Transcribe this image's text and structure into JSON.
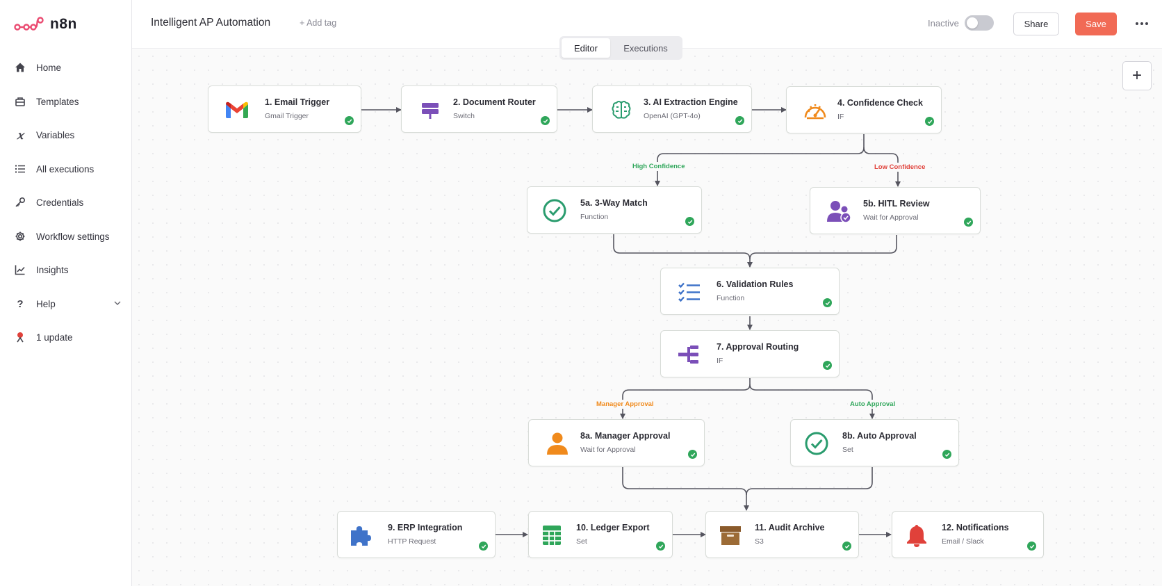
{
  "app": {
    "logo_text": "n8n",
    "accent": "#f16a55"
  },
  "sidebar": {
    "items": [
      {
        "label": "Home",
        "icon": "home-icon"
      },
      {
        "label": "Templates",
        "icon": "templates-icon"
      },
      {
        "label": "Variables",
        "icon": "variables-icon"
      },
      {
        "label": "All executions",
        "icon": "list-icon"
      },
      {
        "label": "Credentials",
        "icon": "key-icon"
      },
      {
        "label": "Workflow settings",
        "icon": "gear-icon"
      },
      {
        "label": "Insights",
        "icon": "chart-icon"
      },
      {
        "label": "Help",
        "icon": "question-icon"
      },
      {
        "label": "1 update",
        "icon": "update-icon"
      }
    ]
  },
  "header": {
    "workflow_title": "Intelligent AP Automation",
    "add_tag": "+ Add tag",
    "status_label": "Inactive",
    "share_label": "Share",
    "save_label": "Save"
  },
  "tabs": {
    "editor": "Editor",
    "executions": "Executions"
  },
  "canvas": {
    "zoom_button": "+"
  },
  "nodes": {
    "n1": {
      "title": "1. Email Trigger",
      "subtitle": "Gmail Trigger"
    },
    "n2": {
      "title": "2. Document Router",
      "subtitle": "Switch"
    },
    "n3": {
      "title": "3. AI Extraction Engine",
      "subtitle": "OpenAI (GPT-4o)"
    },
    "n4": {
      "title": "4. Confidence Check",
      "subtitle": "IF"
    },
    "n5a": {
      "title": "5a. 3-Way Match",
      "subtitle": "Function"
    },
    "n5b": {
      "title": "5b. HITL Review",
      "subtitle": "Wait for Approval"
    },
    "n6": {
      "title": "6. Validation Rules",
      "subtitle": "Function"
    },
    "n7": {
      "title": "7. Approval Routing",
      "subtitle": "IF"
    },
    "n8a": {
      "title": "8a. Manager Approval",
      "subtitle": "Wait for Approval"
    },
    "n8b": {
      "title": "8b. Auto Approval",
      "subtitle": "Set"
    },
    "n9": {
      "title": "9. ERP Integration",
      "subtitle": "HTTP Request"
    },
    "n10": {
      "title": "10. Ledger Export",
      "subtitle": "Set"
    },
    "n11": {
      "title": "11. Audit Archive",
      "subtitle": "S3"
    },
    "n12": {
      "title": "12. Notifications",
      "subtitle": "Email / Slack"
    }
  },
  "edge_labels": {
    "high": {
      "text": "High Confidence",
      "color": "#2fa65a"
    },
    "low": {
      "text": "Low Confidence",
      "color": "#e0413a"
    },
    "manager": {
      "text": "Manager Approval",
      "color": "#f08a1c"
    },
    "auto": {
      "text": "Auto Approval",
      "color": "#2fa65a"
    }
  }
}
